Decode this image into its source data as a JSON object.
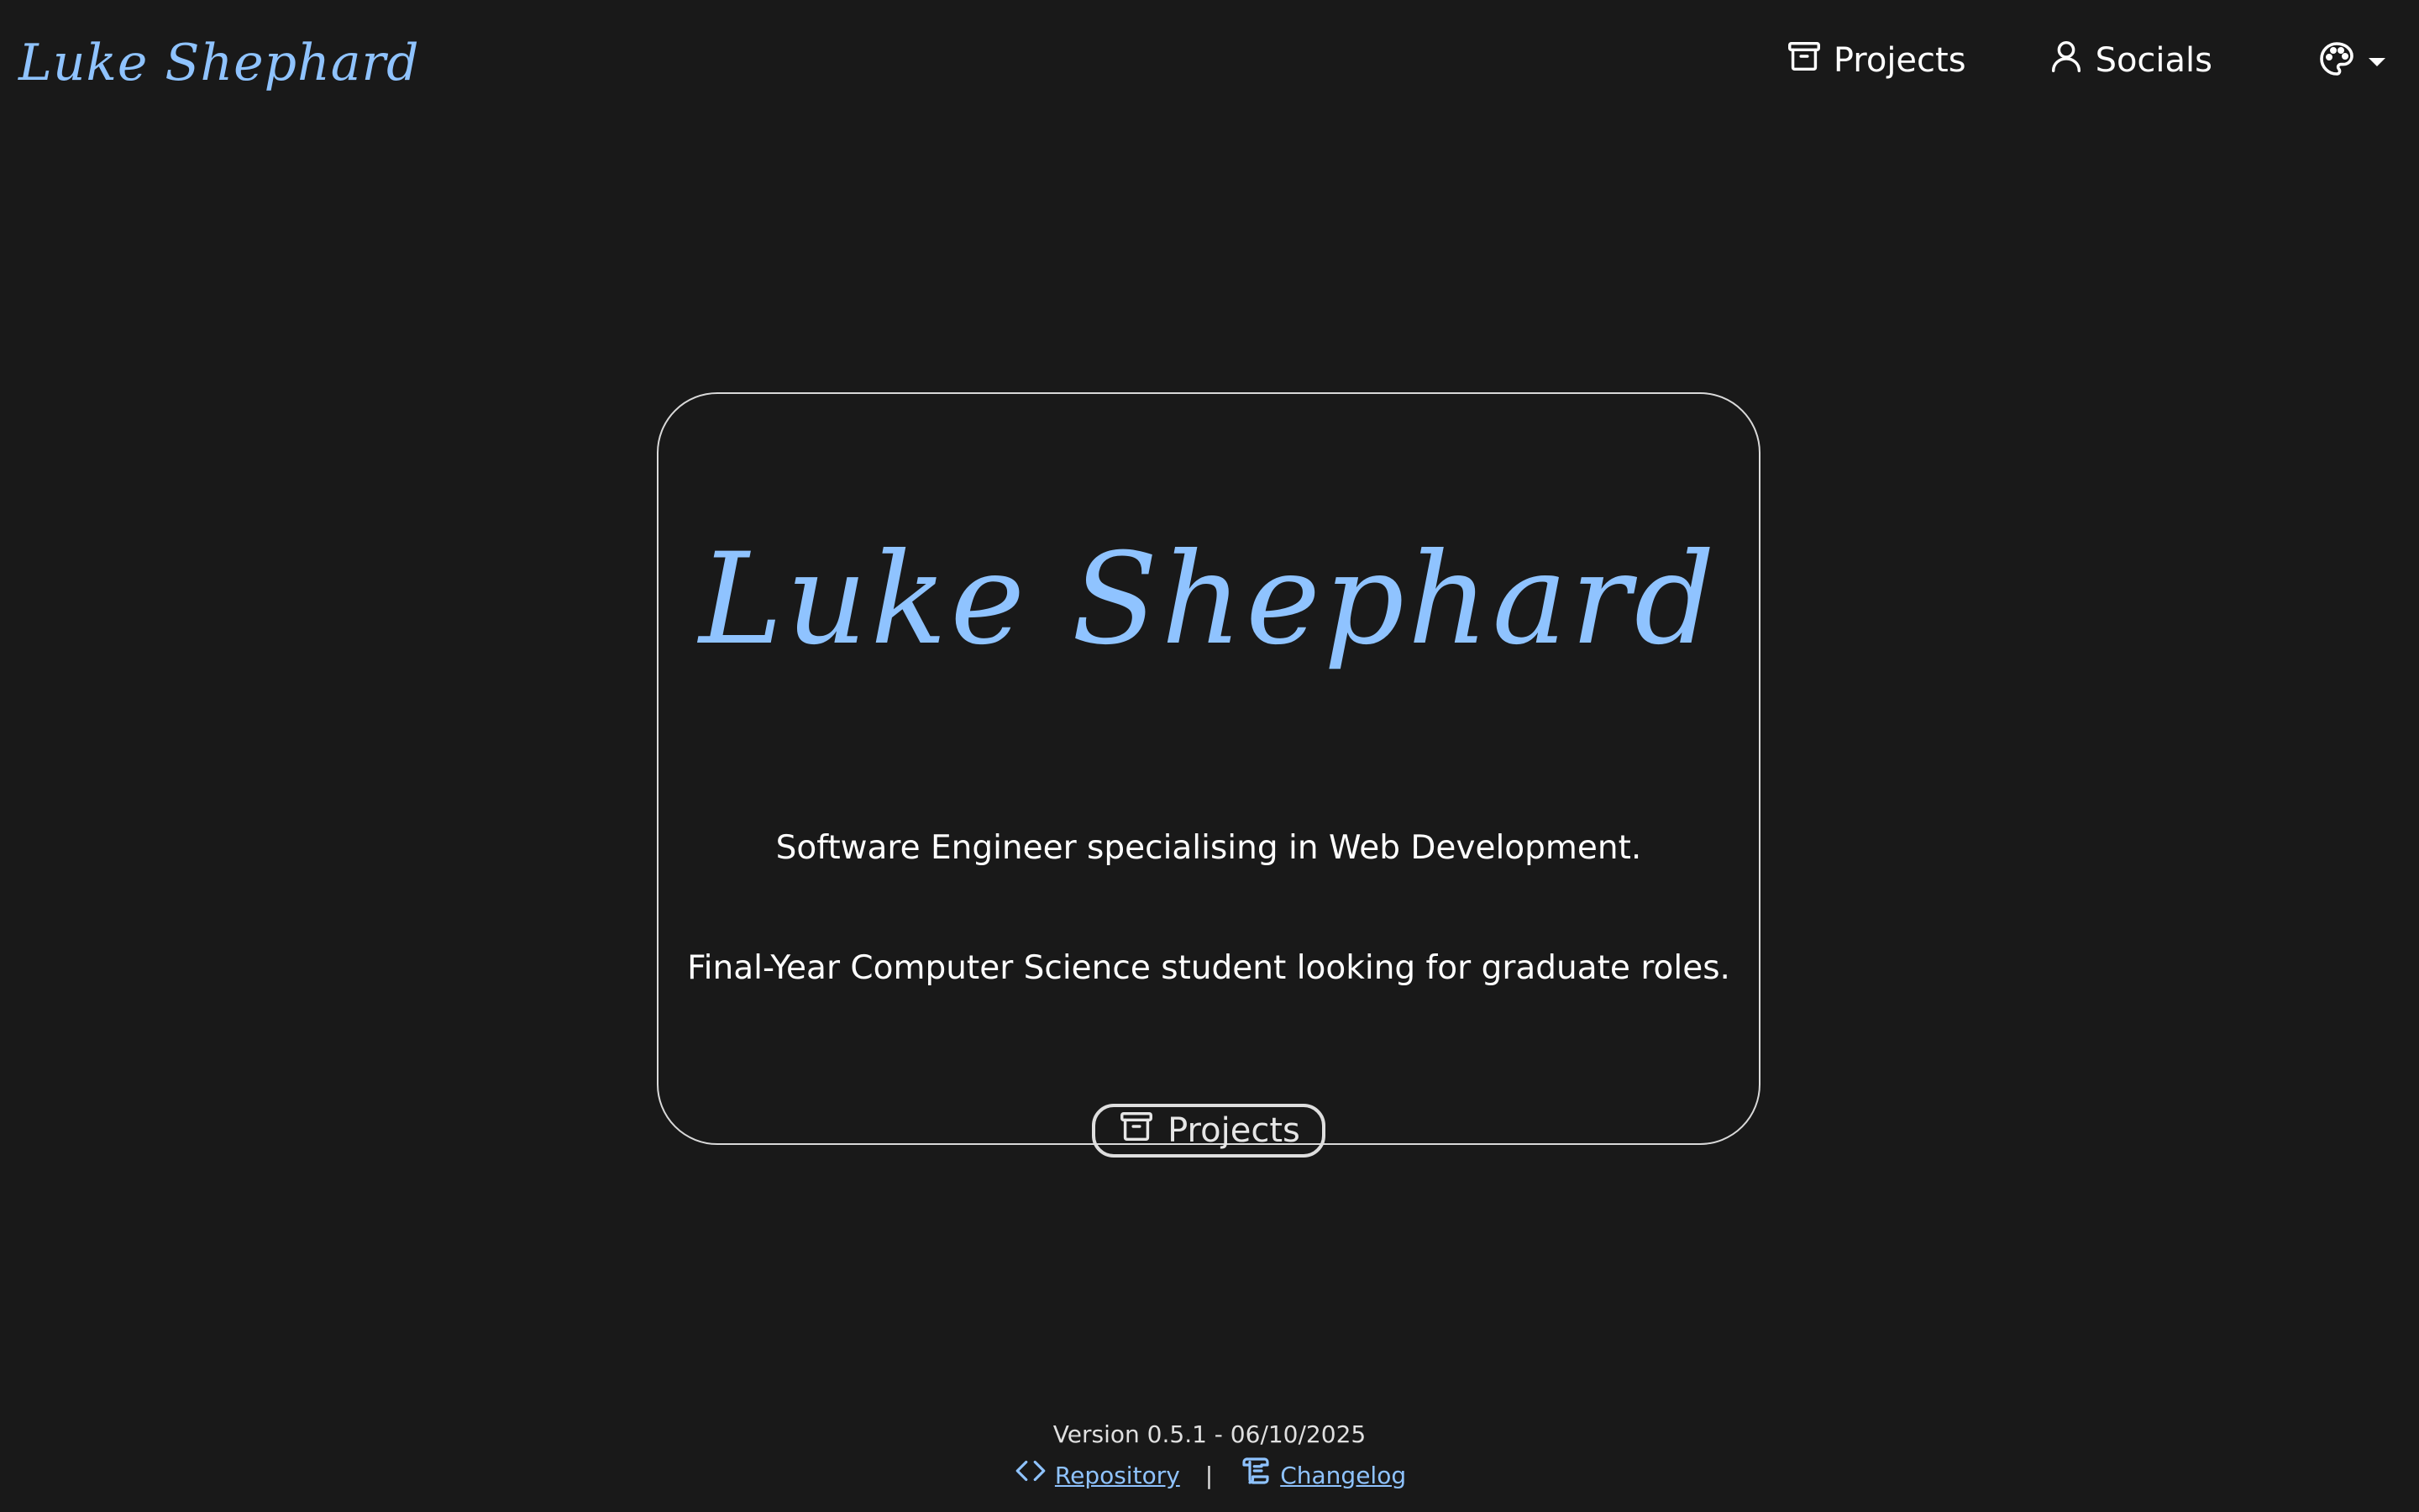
{
  "header": {
    "logo_text": "Luke Shephard",
    "nav": [
      {
        "label": "Projects",
        "icon": "archive-icon"
      },
      {
        "label": "Socials",
        "icon": "user-icon"
      }
    ],
    "theme_toggle": {
      "icon": "palette-icon"
    }
  },
  "hero": {
    "title": "Luke Shephard",
    "tagline_1": "Software Engineer specialising in Web Development.",
    "tagline_2": "Final-Year Computer Science student looking for graduate roles.",
    "cta_label": "Projects",
    "cta_icon": "archive-icon"
  },
  "footer": {
    "version": "Version 0.5.1 - 06/10/2025",
    "repository_label": "Repository",
    "repository_icon": "code-icon",
    "separator": "|",
    "changelog_label": "Changelog",
    "changelog_icon": "scroll-icon"
  },
  "colors": {
    "background": "#191919",
    "accent": "#8fc3ff",
    "text": "#ffffff",
    "border": "#d9d9d9"
  }
}
